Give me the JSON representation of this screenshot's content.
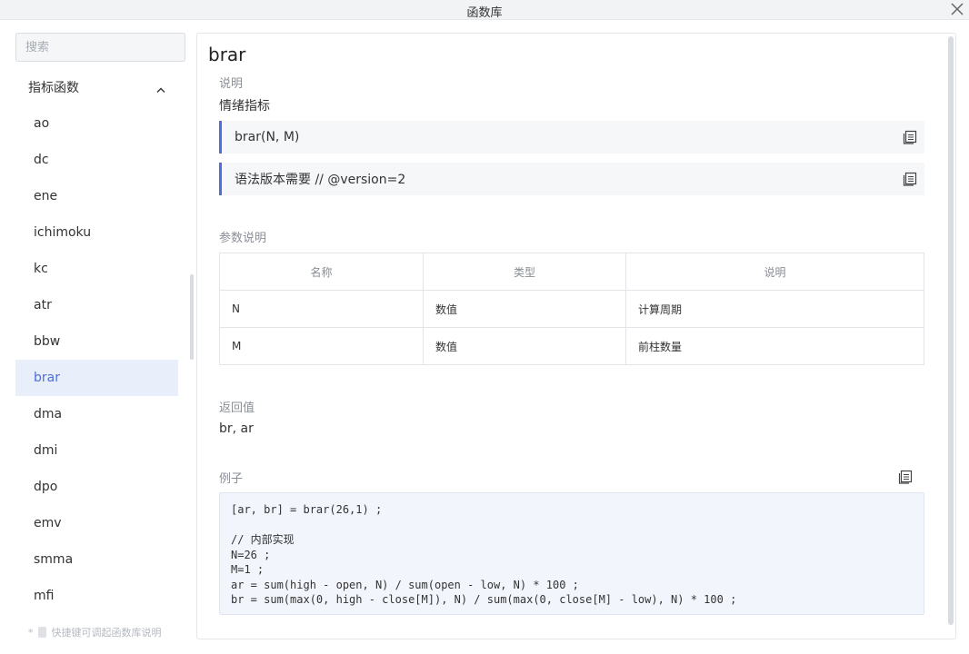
{
  "window": {
    "title": "函数库"
  },
  "sidebar": {
    "search_placeholder": "搜索",
    "group": {
      "label": "指标函数",
      "expanded": true
    },
    "items": [
      {
        "label": "ao",
        "active": false
      },
      {
        "label": "dc",
        "active": false
      },
      {
        "label": "ene",
        "active": false
      },
      {
        "label": "ichimoku",
        "active": false
      },
      {
        "label": "kc",
        "active": false
      },
      {
        "label": "atr",
        "active": false
      },
      {
        "label": "bbw",
        "active": false
      },
      {
        "label": "brar",
        "active": true
      },
      {
        "label": "dma",
        "active": false
      },
      {
        "label": "dmi",
        "active": false
      },
      {
        "label": "dpo",
        "active": false
      },
      {
        "label": "emv",
        "active": false
      },
      {
        "label": "smma",
        "active": false
      },
      {
        "label": "mfi",
        "active": false
      }
    ],
    "hint": {
      "prefix": "*",
      "text": "快捷键可调起函数库说明"
    }
  },
  "detail": {
    "name": "brar",
    "description_label": "说明",
    "description": "情绪指标",
    "signature": "brar(N, M)",
    "version_note": "语法版本需要 // @version=2",
    "params_label": "参数说明",
    "params_table": {
      "headers": [
        "名称",
        "类型",
        "说明"
      ],
      "rows": [
        [
          "N",
          "数值",
          "计算周期"
        ],
        [
          "M",
          "数值",
          "前柱数量"
        ]
      ]
    },
    "return_label": "返回值",
    "return_value": "br, ar",
    "example_label": "例子",
    "example_code": "[ar, br] = brar(26,1) ;\n\n// 内部实现\nN=26 ;\nM=1 ;\nar = sum(high - open, N) / sum(open - low, N) * 100 ;\nbr = sum(max(0, high - close[M]), N) / sum(max(0, close[M] - low), N) * 100 ;"
  },
  "colors": {
    "accent": "#4e6fd7",
    "active_bg": "#e9eefb",
    "code_bg": "#f2f6fc"
  },
  "icons": [
    "close-icon",
    "chevron-up-icon",
    "copy-icon"
  ]
}
